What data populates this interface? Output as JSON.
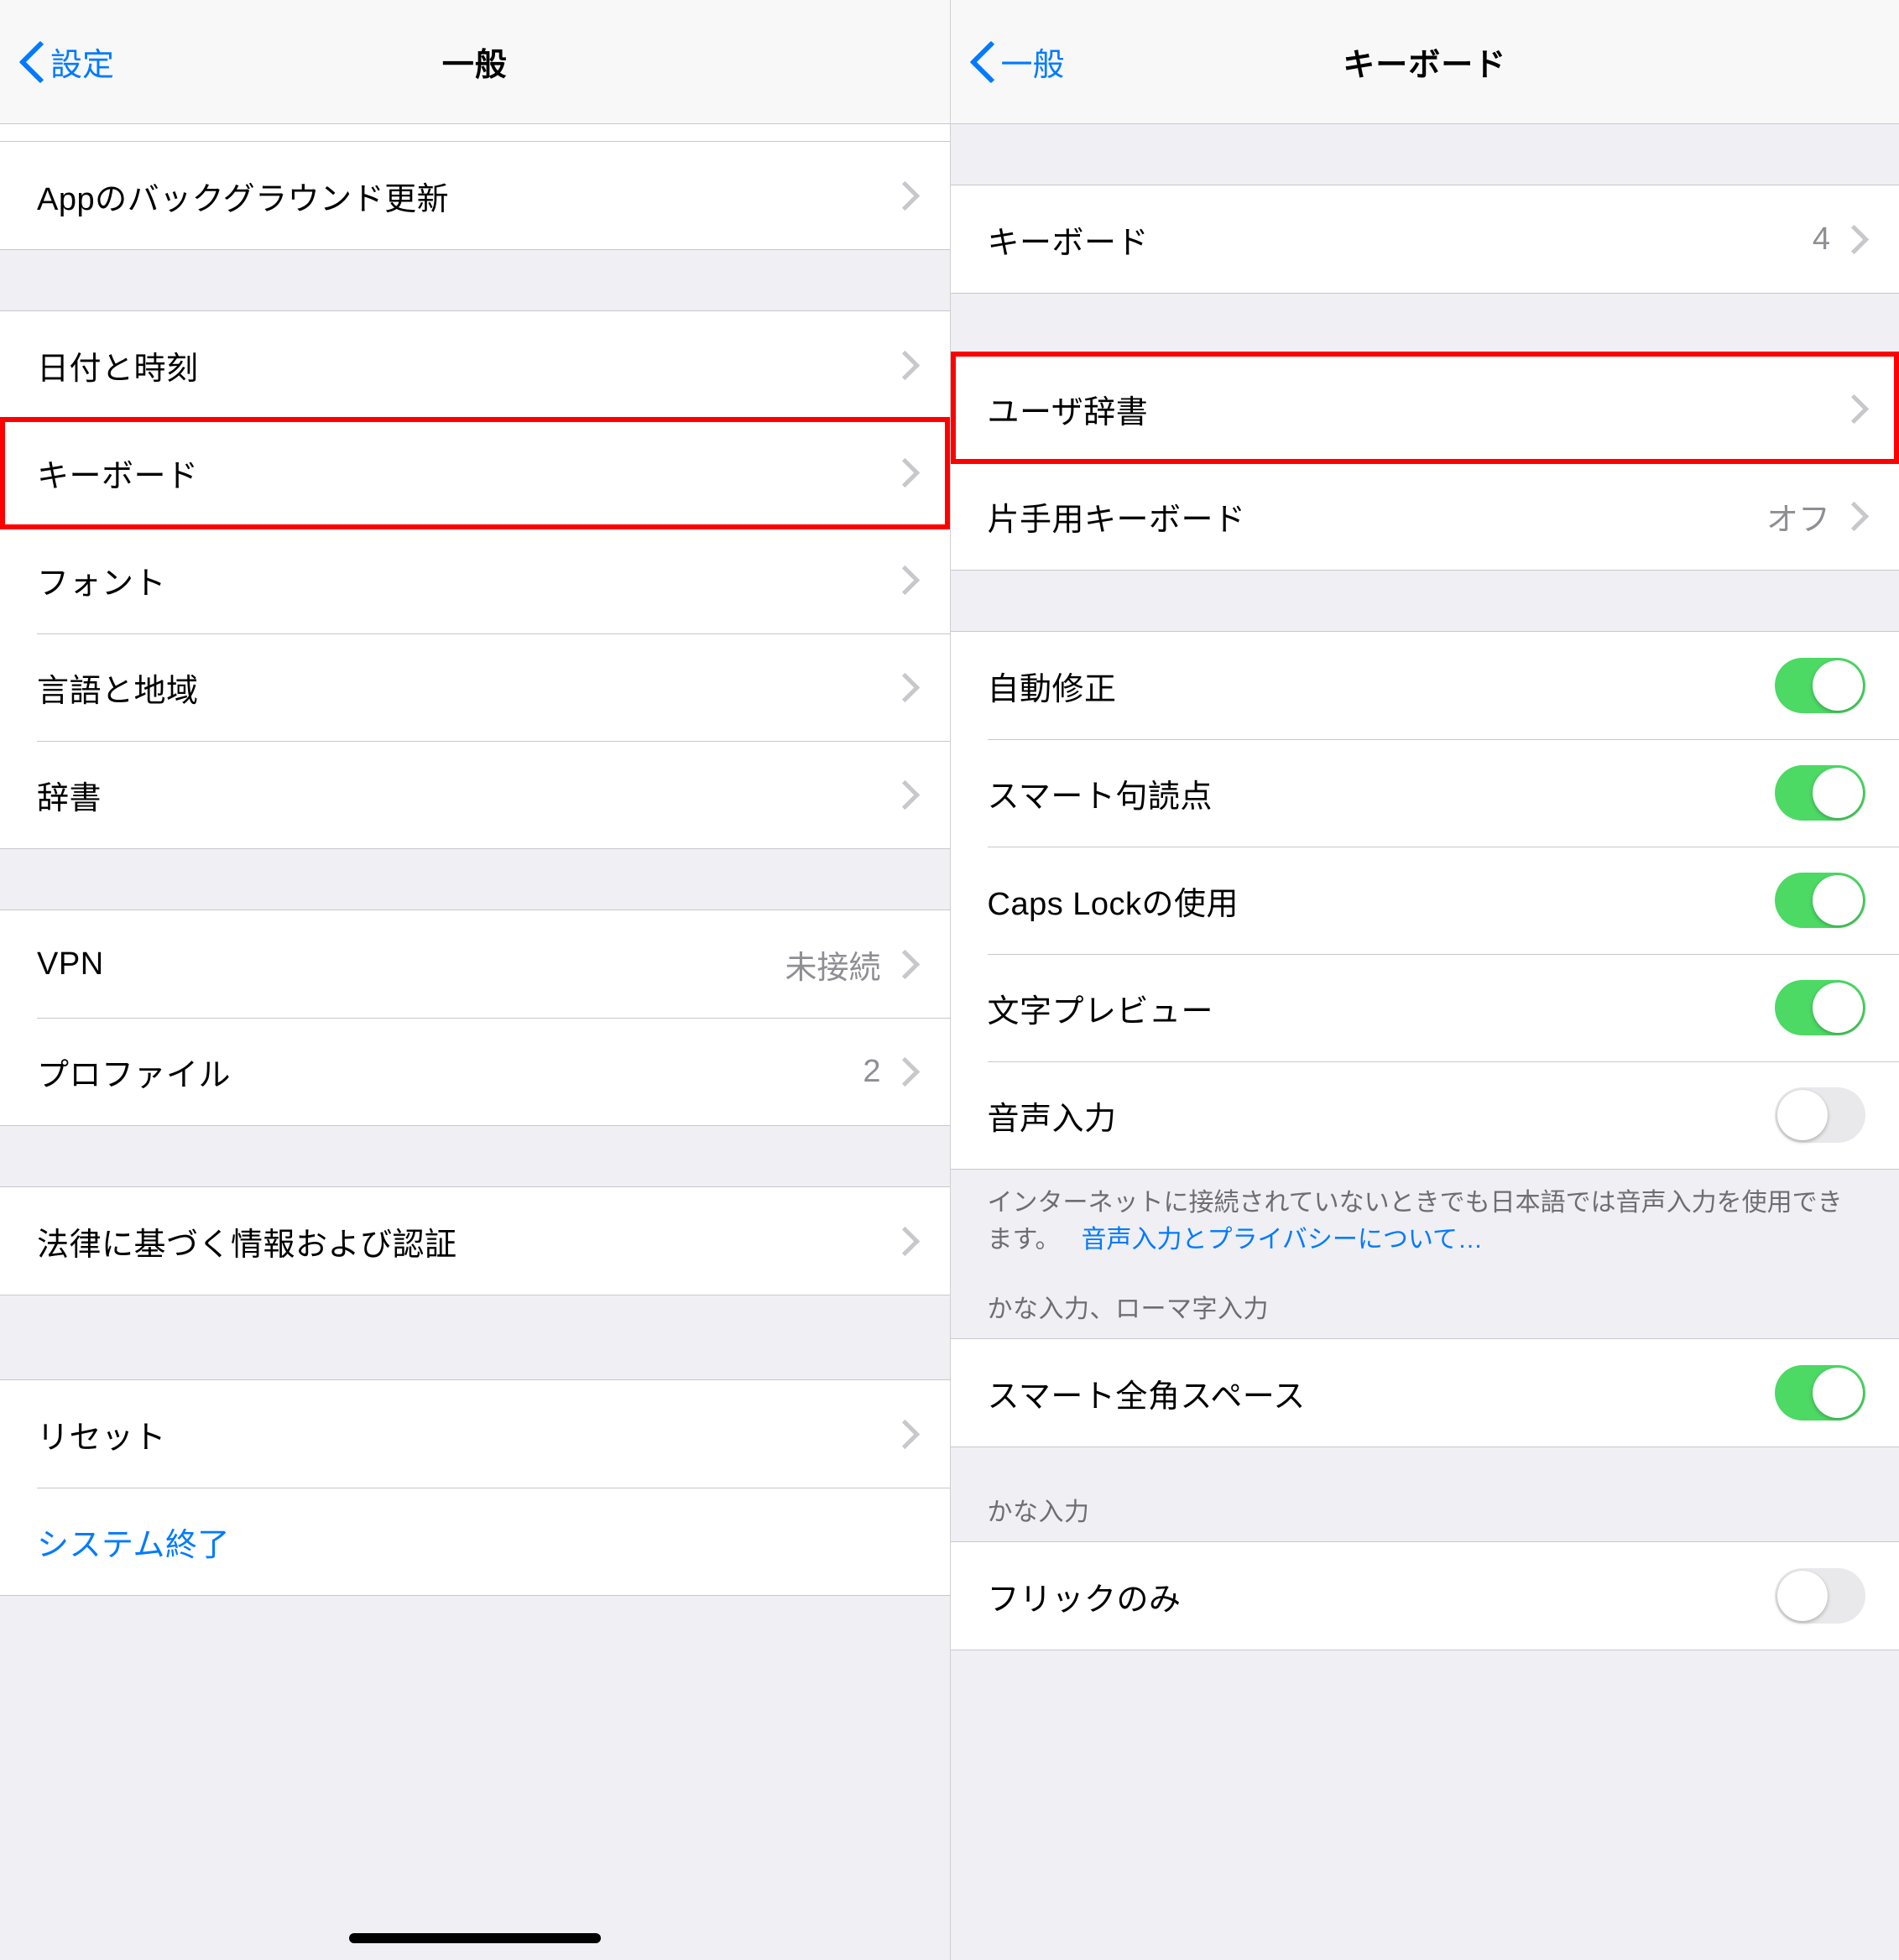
{
  "left": {
    "back_label": "設定",
    "title": "一般",
    "groups": [
      {
        "rows": [
          {
            "id": "row-bg-refresh",
            "label": "Appのバックグラウンド更新",
            "disclosure": true
          }
        ]
      },
      {
        "rows": [
          {
            "id": "row-date-time",
            "label": "日付と時刻",
            "disclosure": true
          },
          {
            "id": "row-keyboard",
            "label": "キーボード",
            "disclosure": true,
            "highlight": true
          },
          {
            "id": "row-fonts",
            "label": "フォント",
            "disclosure": true
          },
          {
            "id": "row-language-region",
            "label": "言語と地域",
            "disclosure": true
          },
          {
            "id": "row-dictionary",
            "label": "辞書",
            "disclosure": true
          }
        ]
      },
      {
        "rows": [
          {
            "id": "row-vpn",
            "label": "VPN",
            "value": "未接続",
            "disclosure": true
          },
          {
            "id": "row-profiles",
            "label": "プロファイル",
            "value": "2",
            "disclosure": true
          }
        ]
      },
      {
        "rows": [
          {
            "id": "row-regulatory",
            "label": "法律に基づく情報および認証",
            "disclosure": true
          }
        ]
      },
      {
        "rows": [
          {
            "id": "row-reset",
            "label": "リセット",
            "disclosure": true
          },
          {
            "id": "row-shutdown",
            "label": "システム終了",
            "link": true
          }
        ]
      }
    ]
  },
  "right": {
    "back_label": "一般",
    "title": "キーボード",
    "group1": [
      {
        "id": "row-keyboards",
        "label": "キーボード",
        "value": "4",
        "disclosure": true
      }
    ],
    "group2": [
      {
        "id": "row-user-dictionary",
        "label": "ユーザ辞書",
        "disclosure": true,
        "highlight": true
      },
      {
        "id": "row-one-handed",
        "label": "片手用キーボード",
        "value": "オフ",
        "disclosure": true
      }
    ],
    "group3": [
      {
        "id": "row-autocorrect",
        "label": "自動修正",
        "toggle": "on"
      },
      {
        "id": "row-smart-punct",
        "label": "スマート句読点",
        "toggle": "on"
      },
      {
        "id": "row-caps-lock",
        "label": "Caps Lockの使用",
        "toggle": "on"
      },
      {
        "id": "row-char-preview",
        "label": "文字プレビュー",
        "toggle": "on"
      },
      {
        "id": "row-dictation",
        "label": "音声入力",
        "toggle": "off"
      }
    ],
    "group3_note_text": "インターネットに接続されていないときでも日本語では音声入力を使用できます。",
    "group3_note_link": "音声入力とプライバシーについて…",
    "section4_header": "かな入力、ローマ字入力",
    "group4": [
      {
        "id": "row-smart-fullwidth-space",
        "label": "スマート全角スペース",
        "toggle": "on"
      }
    ],
    "section5_header": "かな入力",
    "group5": [
      {
        "id": "row-flick-only",
        "label": "フリックのみ",
        "toggle": "off"
      }
    ]
  }
}
